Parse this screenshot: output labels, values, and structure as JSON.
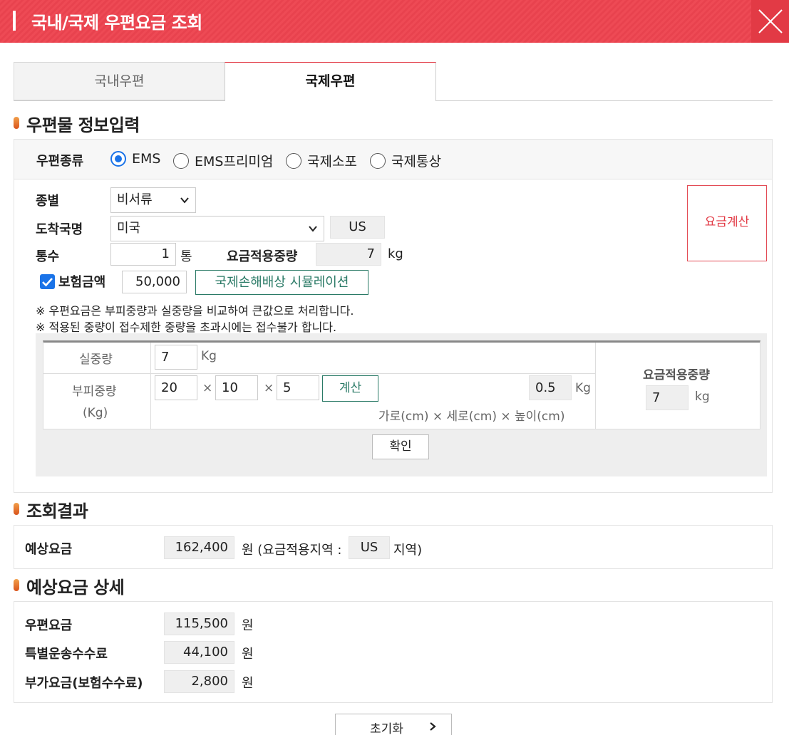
{
  "window": {
    "title": "국내/국제 우편요금 조회",
    "close_icon": "close-icon"
  },
  "tabs": [
    {
      "label": "국내우편",
      "active": false
    },
    {
      "label": "국제우편",
      "active": true
    }
  ],
  "input_section": {
    "title": "우편물 정보입력",
    "mail_type": {
      "label": "우편종류",
      "options": [
        "EMS",
        "EMS프리미엄",
        "국제소포",
        "국제통상"
      ],
      "selected": "EMS"
    },
    "category": {
      "label": "종별",
      "value": "비서류"
    },
    "destination": {
      "label": "도착국명",
      "value": "미국",
      "code": "US"
    },
    "count": {
      "label": "통수",
      "value": "1",
      "unit": "통"
    },
    "applied_weight": {
      "label": "요금적용중량",
      "value": "7",
      "unit": "kg"
    },
    "insurance": {
      "label": "보험금액",
      "checked": true,
      "value": "50,000"
    },
    "simulation_button": "국제손해배상 시뮬레이션",
    "calc_button": "요금계산",
    "notes": [
      "※ 우편요금은 부피중량과 실중량을 비교하여 큰값으로 처리합니다.",
      "※ 적용된 중량이 접수제한 중량을 초과시에는 접수불가 합니다."
    ]
  },
  "weight_calc": {
    "actual_label": "실중량",
    "actual_value": "7",
    "actual_unit": "Kg",
    "volume_label": "부피중량",
    "volume_sublabel": "(Kg)",
    "width": "20",
    "length": "10",
    "height": "5",
    "times": "×",
    "calc_button": "계산",
    "volume_result": "0.5",
    "volume_unit": "Kg",
    "dims_hint": "가로(cm) × 세로(cm) × 높이(cm)",
    "applied_label": "요금적용중량",
    "applied_value": "7",
    "applied_unit": "kg",
    "confirm_button": "확인"
  },
  "result": {
    "title": "조회결과",
    "label": "예상요금",
    "value": "162,400",
    "unit_prefix": "원 (요금적용지역 :",
    "zone": "US",
    "unit_suffix": "지역)"
  },
  "detail": {
    "title": "예상요금 상세",
    "rows": [
      {
        "label": "우편요금",
        "value": "115,500",
        "unit": "원"
      },
      {
        "label": "특별운송수수료",
        "value": "44,100",
        "unit": "원"
      },
      {
        "label": "부가요금(보험수수료)",
        "value": "2,800",
        "unit": "원"
      }
    ]
  },
  "reset_button": "초기화",
  "colors": {
    "title_bar": "#ee4a55",
    "accent": "#e23a45",
    "teal": "#2a7a66",
    "radio": "#1a73e8"
  }
}
